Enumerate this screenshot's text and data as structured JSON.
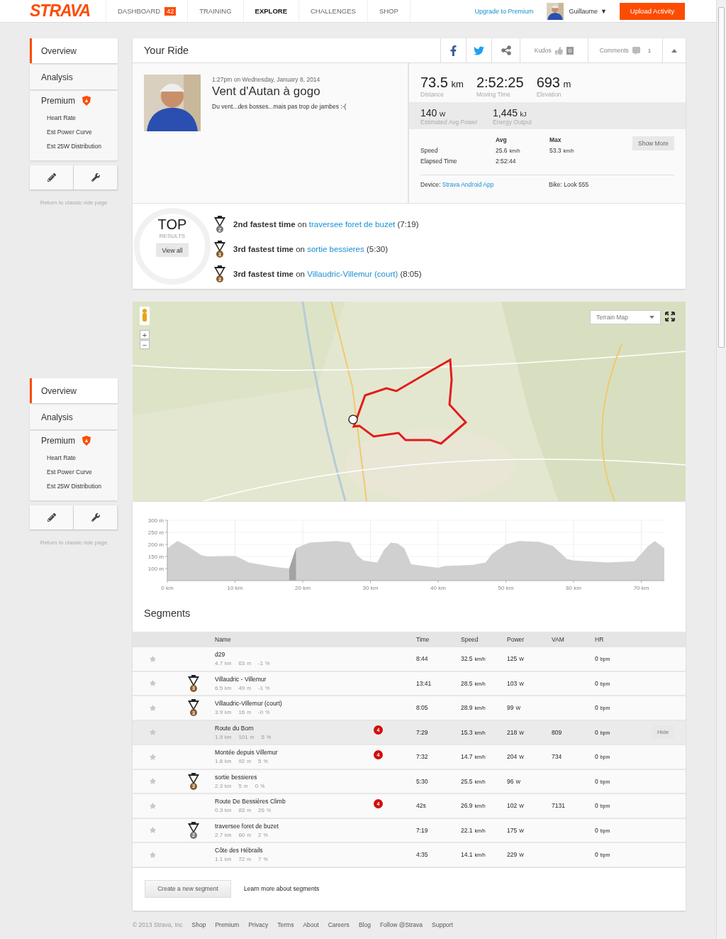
{
  "header": {
    "logo": "STRAVA",
    "nav": [
      {
        "label": "DASHBOARD",
        "badge": "42",
        "selected": false
      },
      {
        "label": "TRAINING",
        "selected": false
      },
      {
        "label": "EXPLORE",
        "selected": true
      },
      {
        "label": "CHALLENGES",
        "selected": false
      },
      {
        "label": "SHOP",
        "selected": false
      }
    ],
    "upgrade_link": "Upgrade to Premium",
    "user": {
      "name": "Guillaume",
      "caret": "▼"
    },
    "upload_button": "Upload Activity"
  },
  "sidebars": [
    {
      "items": [
        {
          "label": "Overview",
          "selected": true
        },
        {
          "label": "Analysis",
          "selected": false
        },
        {
          "label": "Premium",
          "selected": false,
          "premium": true,
          "children": [
            {
              "label": "Heart Rate"
            },
            {
              "label": "Est Power Curve"
            },
            {
              "label": "Est 25W Distribution"
            }
          ]
        }
      ],
      "return_link": "Return to classic ride page"
    },
    {
      "items": [
        {
          "label": "Overview",
          "selected": true
        },
        {
          "label": "Analysis",
          "selected": false
        },
        {
          "label": "Premium",
          "selected": false,
          "premium": true,
          "children": [
            {
              "label": "Heart Rate"
            },
            {
              "label": "Est Power Curve"
            },
            {
              "label": "Est 25W Distribution"
            }
          ]
        }
      ],
      "return_link": "Return to classic ride page"
    }
  ],
  "ride": {
    "title": "Your Ride",
    "kudos": {
      "label": "Kudos",
      "count": "0"
    },
    "comments": {
      "label": "Comments",
      "count": "1"
    },
    "datetime": "1:27pm on Wednesday, January 8, 2014",
    "name": "Vent d'Autan à gogo",
    "description": "Du vent...des bosses...mais pas trop de jambes :-(",
    "primary_stats": [
      {
        "value": "73.5",
        "unit": "km",
        "label": "Distance"
      },
      {
        "value": "2:52:25",
        "label": "Moving Time"
      },
      {
        "value": "693",
        "unit": "m",
        "label": "Elevation"
      }
    ],
    "secondary_stats": [
      {
        "value": "140",
        "unit": "W",
        "label": "Estimated Avg Power"
      },
      {
        "value": "1,445",
        "unit": "kJ",
        "label": "Energy Output"
      }
    ],
    "more_stats": {
      "columns": [
        "Avg",
        "Max"
      ],
      "rows": [
        {
          "label": "Speed",
          "avg": [
            "25.6",
            "km/h"
          ],
          "max": [
            "53.3",
            "km/h"
          ]
        },
        {
          "label": "Elapsed Time",
          "avg": [
            "2:52:44"
          ]
        }
      ]
    },
    "show_more": "Show More",
    "device": {
      "label": "Device:",
      "value": "Strava Android App"
    },
    "bike": "Bike: Look 555"
  },
  "top_results": {
    "title": "TOP",
    "subtitle": "RESULTS",
    "view_all": "View all",
    "items": [
      {
        "rank": "2",
        "text": "**2nd fastest time** on",
        "segment": "traversee foret de buzet",
        "time": "(7:19)"
      },
      {
        "rank": "3",
        "text": "**3rd fastest time** on",
        "segment": "sortie bessieres",
        "time": "(5:30)"
      },
      {
        "rank": "3",
        "text": "**3rd fastest time** on",
        "segment": "Villaudric-Villemur (court)",
        "time": "(8:05)"
      }
    ]
  },
  "map": {
    "kind": "picture",
    "map_type": "Terrain Map",
    "zoom_in": "+",
    "zoom_out": "−"
  },
  "elevation": {
    "chart_data": {
      "type": "area",
      "xlim": [
        0,
        73.4
      ],
      "ylim": [
        50,
        300
      ],
      "grid": true,
      "x": [
        0,
        1.5,
        3,
        5,
        6,
        10,
        11,
        12,
        15,
        17,
        18,
        19,
        20,
        21,
        25,
        27,
        28,
        29,
        31,
        32,
        33,
        34,
        35,
        36,
        38,
        40,
        41,
        45,
        47,
        48,
        50,
        52,
        55,
        57,
        59,
        60,
        65,
        69,
        71,
        72,
        73.4
      ],
      "series": [
        {
          "color": "#d0d0d0",
          "values": [
            184,
            214,
            193,
            155,
            150,
            152,
            140,
            125,
            110,
            103,
            100,
            184,
            196,
            207,
            214,
            207,
            155,
            133,
            125,
            177,
            207,
            204,
            184,
            118,
            110,
            103,
            110,
            115,
            125,
            162,
            200,
            214,
            210,
            193,
            140,
            133,
            125,
            130,
            193,
            214,
            184
          ]
        },
        {
          "color": "#a3a3a3",
          "values": [
            null,
            null,
            null,
            null,
            null,
            null,
            null,
            null,
            null,
            null,
            100,
            184,
            null,
            null,
            null,
            null,
            null,
            null,
            null,
            null,
            null,
            null,
            null,
            null,
            null,
            null,
            null,
            null,
            null,
            null,
            null,
            null,
            null,
            null,
            null,
            null,
            null,
            null,
            null,
            null,
            null
          ]
        }
      ],
      "xticks": [
        {
          "value": 0,
          "label": "0 km"
        },
        {
          "value": 10,
          "label": "10 km"
        },
        {
          "value": 20,
          "label": "20 km"
        },
        {
          "value": 30,
          "label": "30 km"
        },
        {
          "value": 40,
          "label": "40 km"
        },
        {
          "value": 50,
          "label": "50 km"
        },
        {
          "value": 60,
          "label": "60 km"
        },
        {
          "value": 70,
          "label": "70 km"
        }
      ],
      "yticks": [
        {
          "value": 100,
          "label": "100 m"
        },
        {
          "value": 150,
          "label": "150 m"
        },
        {
          "value": 200,
          "label": "200 m"
        },
        {
          "value": 250,
          "label": "250 m"
        },
        {
          "value": 300,
          "label": "300 m"
        }
      ]
    }
  },
  "segments": {
    "title": "Segments",
    "columns": [
      "Name",
      "Time",
      "Speed",
      "Power",
      "VAM",
      "HR"
    ],
    "rows": [
      {
        "name": "d29",
        "stats": [
          [
            "4.7",
            "km"
          ],
          [
            "63",
            "m"
          ],
          [
            "-1",
            "%"
          ]
        ],
        "time": "8:44",
        "speed": [
          "32.5",
          "km/h"
        ],
        "power": [
          "125",
          "W"
        ],
        "hr": [
          "0",
          "bpm"
        ],
        "hovered": false
      },
      {
        "medal": "3",
        "name": "Villaudric - Villemur",
        "stats": [
          [
            "6.5",
            "km"
          ],
          [
            "49",
            "m"
          ],
          [
            "-1",
            "%"
          ]
        ],
        "time": "13:41",
        "speed": [
          "28.5",
          "km/h"
        ],
        "power": [
          "103",
          "W"
        ],
        "hr": [
          "0",
          "bpm"
        ],
        "hovered": false
      },
      {
        "medal": "3",
        "name": "Villaudric-Villemur (court)",
        "stats": [
          [
            "3.9",
            "km"
          ],
          [
            "16",
            "m"
          ],
          [
            "-0",
            "%"
          ]
        ],
        "time": "8:05",
        "speed": [
          "28.9",
          "km/h"
        ],
        "power": [
          "99",
          "W"
        ],
        "hr": [
          "0",
          "bpm"
        ],
        "hovered": false
      },
      {
        "name": "Route du Born",
        "stats": [
          [
            "1.9",
            "km"
          ],
          [
            "101",
            "m"
          ],
          [
            "5",
            "%"
          ]
        ],
        "category": "4",
        "time": "7:29",
        "speed": [
          "15.3",
          "km/h"
        ],
        "power": [
          "218",
          "W"
        ],
        "vam": "809",
        "hr": [
          "0",
          "bpm"
        ],
        "hovered": true,
        "hide_button": "Hide"
      },
      {
        "name": "Montée depuis Villemur",
        "stats": [
          [
            "1.8",
            "km"
          ],
          [
            "92",
            "m"
          ],
          [
            "5",
            "%"
          ]
        ],
        "category": "4",
        "time": "7:32",
        "speed": [
          "14.7",
          "km/h"
        ],
        "power": [
          "204",
          "W"
        ],
        "vam": "734",
        "hr": [
          "0",
          "bpm"
        ],
        "hovered": false
      },
      {
        "medal": "3",
        "name": "sortie bessieres",
        "stats": [
          [
            "2.3",
            "km"
          ],
          [
            "5",
            "m"
          ],
          [
            "0",
            "%"
          ]
        ],
        "time": "5:30",
        "speed": [
          "25.5",
          "km/h"
        ],
        "power": [
          "96",
          "W"
        ],
        "hr": [
          "0",
          "bpm"
        ],
        "hovered": false
      },
      {
        "name": "Route De Bessières Climb",
        "stats": [
          [
            "0.3",
            "km"
          ],
          [
            "83",
            "m"
          ],
          [
            "26",
            "%"
          ]
        ],
        "category": "4",
        "time": "42s",
        "speed": [
          "26.9",
          "km/h"
        ],
        "power": [
          "102",
          "W"
        ],
        "vam": "7131",
        "hr": [
          "0",
          "bpm"
        ],
        "hovered": false
      },
      {
        "medal": "2",
        "name": "traversee foret de buzet",
        "stats": [
          [
            "2.7",
            "km"
          ],
          [
            "60",
            "m"
          ],
          [
            "2",
            "%"
          ]
        ],
        "time": "7:19",
        "speed": [
          "22.1",
          "km/h"
        ],
        "power": [
          "175",
          "W"
        ],
        "hr": [
          "0",
          "bpm"
        ],
        "hovered": false
      },
      {
        "name": "Côte des Hébrails",
        "stats": [
          [
            "1.1",
            "km"
          ],
          [
            "72",
            "m"
          ],
          [
            "7",
            "%"
          ]
        ],
        "time": "4:35",
        "speed": [
          "14.1",
          "km/h"
        ],
        "power": [
          "229",
          "W"
        ],
        "hr": [
          "0",
          "bpm"
        ],
        "hovered": false
      }
    ],
    "create_button": "Create a new segment",
    "learn_link": "Learn more about segments"
  },
  "footer": {
    "copyright": "© 2013 Strava, Inc",
    "links": [
      "Shop",
      "Premium",
      "Privacy",
      "Terms",
      "About",
      "Careers",
      "Blog",
      "Follow @Strava",
      "Support"
    ]
  }
}
